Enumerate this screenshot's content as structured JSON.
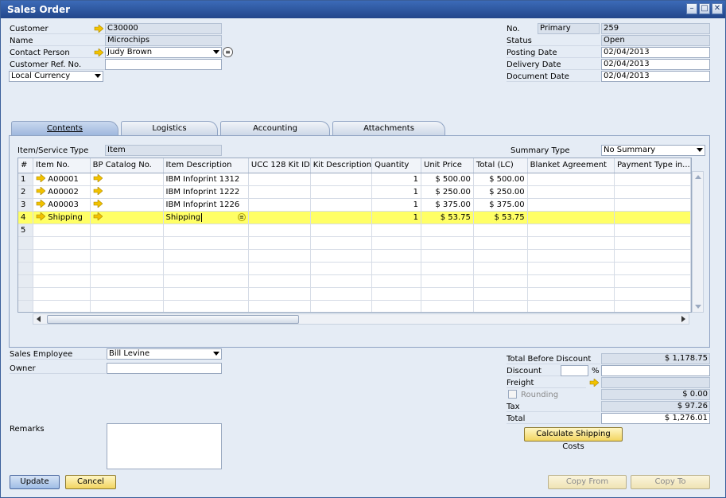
{
  "window": {
    "title": "Sales Order"
  },
  "header_left": {
    "customer_label": "Customer",
    "customer_value": "C30000",
    "name_label": "Name",
    "name_value": "Microchips",
    "contact_label": "Contact Person",
    "contact_value": "Judy Brown",
    "ref_label": "Customer Ref. No.",
    "ref_value": "",
    "currency_value": "Local Currency"
  },
  "header_right": {
    "no_label": "No.",
    "series_value": "Primary",
    "no_value": "259",
    "status_label": "Status",
    "status_value": "Open",
    "posting_label": "Posting Date",
    "posting_value": "02/04/2013",
    "delivery_label": "Delivery Date",
    "delivery_value": "02/04/2013",
    "document_label": "Document Date",
    "document_value": "02/04/2013"
  },
  "tabs": [
    {
      "label": "Contents"
    },
    {
      "label": "Logistics"
    },
    {
      "label": "Accounting"
    },
    {
      "label": "Attachments"
    }
  ],
  "contents": {
    "item_type_label": "Item/Service Type",
    "item_type_value": "Item",
    "summary_label": "Summary Type",
    "summary_value": "No Summary"
  },
  "grid": {
    "columns": [
      "#",
      "Item No.",
      "BP Catalog No.",
      "Item Description",
      "UCC 128 Kit ID",
      "Kit Description",
      "Quantity",
      "Unit Price",
      "Total (LC)",
      "Blanket Agreement",
      "Payment Type in..."
    ],
    "rows": [
      {
        "num": "1",
        "item_no": "A00001",
        "desc": "IBM Infoprint 1312",
        "qty": "1",
        "price": "$ 500.00",
        "total": "$ 500.00"
      },
      {
        "num": "2",
        "item_no": "A00002",
        "desc": "IBM Infoprint 1222",
        "qty": "1",
        "price": "$ 250.00",
        "total": "$ 250.00"
      },
      {
        "num": "3",
        "item_no": "A00003",
        "desc": "IBM Infoprint 1226",
        "qty": "1",
        "price": "$ 375.00",
        "total": "$ 375.00"
      },
      {
        "num": "4",
        "item_no": "Shipping",
        "desc": "Shipping",
        "qty": "1",
        "price": "$ 53.75",
        "total": "$ 53.75"
      },
      {
        "num": "5",
        "item_no": "",
        "desc": "",
        "qty": "",
        "price": "",
        "total": ""
      }
    ]
  },
  "footer_left": {
    "employee_label": "Sales Employee",
    "employee_value": "Bill Levine",
    "owner_label": "Owner",
    "owner_value": "",
    "remarks_label": "Remarks",
    "remarks_value": ""
  },
  "totals": {
    "before_discount_label": "Total Before Discount",
    "before_discount_value": "$ 1,178.75",
    "discount_label": "Discount",
    "discount_pct": "",
    "pct_sign": "%",
    "discount_value": "",
    "freight_label": "Freight",
    "freight_value": "",
    "rounding_label": "Rounding",
    "rounding_value": "$ 0.00",
    "tax_label": "Tax",
    "tax_value": "$ 97.26",
    "total_label": "Total",
    "total_value": "$ 1,276.01"
  },
  "buttons": {
    "calc_shipping": "Calculate Shipping Costs",
    "update": "Update",
    "cancel": "Cancel",
    "copy_from": "Copy From",
    "copy_to": "Copy To"
  },
  "colors": {
    "highlight": "#ffff66",
    "arrow": "#f2c200",
    "title_bar": "#2b5298"
  },
  "icons": {
    "link_arrow": "link-arrow-icon",
    "dropdown": "chevron-down-icon"
  }
}
